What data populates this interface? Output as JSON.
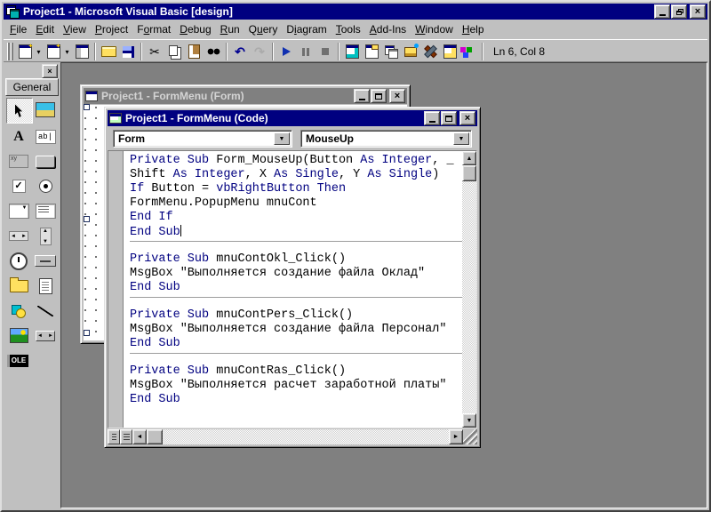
{
  "app": {
    "title": "Project1 - Microsoft Visual Basic [design]"
  },
  "menubar": {
    "items": [
      {
        "label": "File",
        "accel": 0
      },
      {
        "label": "Edit",
        "accel": 0
      },
      {
        "label": "View",
        "accel": 0
      },
      {
        "label": "Project",
        "accel": 0
      },
      {
        "label": "Format",
        "accel": 1
      },
      {
        "label": "Debug",
        "accel": 0
      },
      {
        "label": "Run",
        "accel": 0
      },
      {
        "label": "Query",
        "accel": 1
      },
      {
        "label": "Diagram",
        "accel": 1
      },
      {
        "label": "Tools",
        "accel": 0
      },
      {
        "label": "Add-Ins",
        "accel": 0
      },
      {
        "label": "Window",
        "accel": 0
      },
      {
        "label": "Help",
        "accel": 0
      }
    ]
  },
  "toolbar": {
    "items": [
      {
        "name": "add-project",
        "dropdown": true
      },
      {
        "name": "add-form",
        "dropdown": true
      },
      {
        "name": "menu-editor"
      },
      "sep",
      {
        "name": "open-project"
      },
      {
        "name": "save-project"
      },
      "sep",
      {
        "name": "cut"
      },
      {
        "name": "copy"
      },
      {
        "name": "paste"
      },
      {
        "name": "find"
      },
      "sep",
      {
        "name": "undo"
      },
      {
        "name": "redo",
        "disabled": true
      },
      "sep",
      {
        "name": "start"
      },
      {
        "name": "break"
      },
      {
        "name": "end"
      },
      "sep",
      {
        "name": "project-explorer"
      },
      {
        "name": "properties-window"
      },
      {
        "name": "form-layout"
      },
      {
        "name": "object-browser"
      },
      {
        "name": "toolbox"
      },
      {
        "name": "data-view"
      },
      {
        "name": "component-manager"
      },
      "sep"
    ],
    "status": "Ln 6, Col 8"
  },
  "toolbox": {
    "tab": "General",
    "tools": [
      {
        "name": "pointer",
        "pressed": true
      },
      {
        "name": "picturebox"
      },
      {
        "name": "label",
        "label": "A"
      },
      {
        "name": "textbox",
        "label": "ab|"
      },
      {
        "name": "frame",
        "label": "xy"
      },
      {
        "name": "commandbutton"
      },
      {
        "name": "checkbox"
      },
      {
        "name": "optionbutton"
      },
      {
        "name": "combobox"
      },
      {
        "name": "listbox"
      },
      {
        "name": "hscrollbar",
        "left": "◄",
        "right": "►"
      },
      {
        "name": "vscrollbar",
        "up": "▲",
        "down": "▼"
      },
      {
        "name": "timer"
      },
      {
        "name": "drivelistbox"
      },
      {
        "name": "dirlistbox"
      },
      {
        "name": "filelistbox"
      },
      {
        "name": "shape"
      },
      {
        "name": "line"
      },
      {
        "name": "image"
      },
      {
        "name": "data",
        "left": "◄",
        "right": "►"
      },
      {
        "name": "ole",
        "label": "OLE"
      }
    ]
  },
  "form_window": {
    "title": "Project1 - FormMenu (Form)"
  },
  "code_window": {
    "title": "Project1 - FormMenu (Code)",
    "object_combo": "Form",
    "procedure_combo": "MouseUp",
    "blocks": [
      {
        "lines": [
          [
            [
              "kw",
              "Private Sub "
            ],
            [
              "id",
              "Form_MouseUp(Button "
            ],
            [
              "kw",
              "As Integer"
            ],
            [
              "id",
              ", _"
            ]
          ],
          [
            [
              "id",
              "Shift "
            ],
            [
              "kw",
              "As Integer"
            ],
            [
              "id",
              ", X "
            ],
            [
              "kw",
              "As Single"
            ],
            [
              "id",
              ", Y "
            ],
            [
              "kw",
              "As Single"
            ],
            [
              "id",
              ")"
            ]
          ],
          [
            [
              "kw",
              "If "
            ],
            [
              "id",
              "Button = "
            ],
            [
              "kw",
              "vbRightButton Then"
            ]
          ],
          [
            [
              "id",
              "FormMenu.PopupMenu mnuCont"
            ]
          ],
          [
            [
              "kw",
              "End If"
            ]
          ],
          [
            [
              "kw",
              "End Sub"
            ],
            [
              "caret",
              ""
            ]
          ]
        ]
      },
      {
        "lines": [
          [
            [
              "kw",
              "Private Sub "
            ],
            [
              "id",
              "mnuContOkl_Click()"
            ]
          ],
          [
            [
              "id",
              "MsgBox \"Выполняется создание файла Оклад\""
            ]
          ],
          [
            [
              "kw",
              "End Sub"
            ]
          ]
        ]
      },
      {
        "lines": [
          [
            [
              "kw",
              "Private Sub "
            ],
            [
              "id",
              "mnuContPers_Click()"
            ]
          ],
          [
            [
              "id",
              "MsgBox \"Выполняется создание файла Персонал\""
            ]
          ],
          [
            [
              "kw",
              "End Sub"
            ]
          ]
        ]
      },
      {
        "lines": [
          [
            [
              "kw",
              "Private Sub "
            ],
            [
              "id",
              "mnuContRas_Click()"
            ]
          ],
          [
            [
              "id",
              "MsgBox \"Выполняется расчет заработной платы\""
            ]
          ],
          [
            [
              "kw",
              "End Sub"
            ]
          ]
        ]
      }
    ]
  },
  "colors": {
    "titlebar_active": "#000080",
    "titlebar_inactive": "#808080",
    "chrome": "#c0c0c0",
    "mdi_background": "#808080",
    "keyword": "#000080",
    "code_text": "#000000"
  }
}
